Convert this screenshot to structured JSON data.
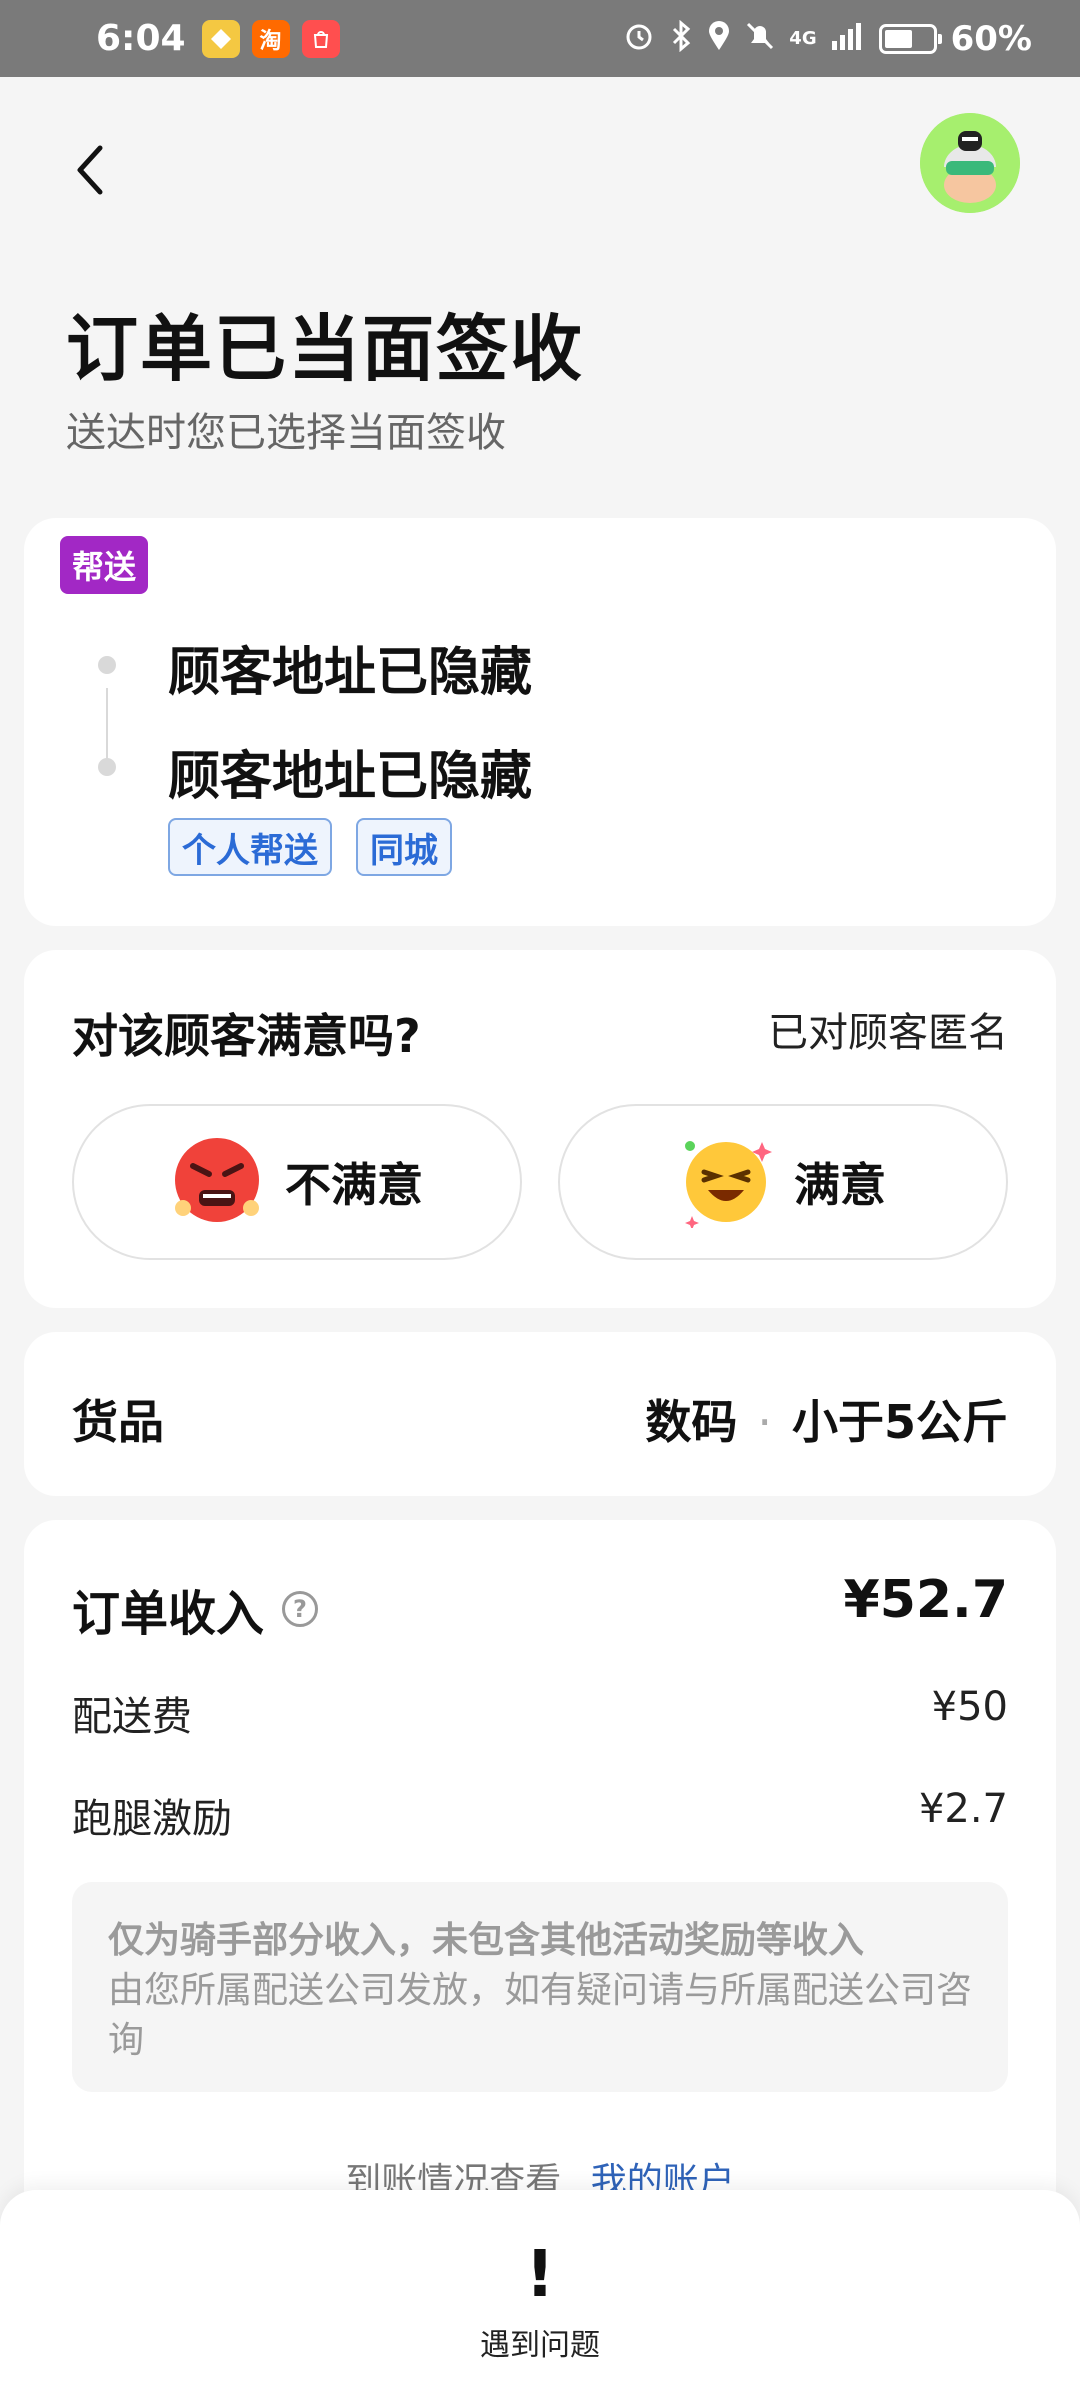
{
  "status_bar": {
    "time": "6:04",
    "apps": [
      {
        "name": "messaging-app-icon",
        "glyph": "",
        "color": "#f4c842"
      },
      {
        "name": "taobao-app-icon",
        "glyph": "淘",
        "color": "#ff6a00"
      },
      {
        "name": "huawei-app-icon",
        "glyph": "",
        "color": "#ff4f4f"
      }
    ],
    "network": "4G",
    "battery_percent": "60%",
    "battery_level": 0.6
  },
  "header": {
    "title": "订单已当面签收",
    "subtitle": "送达时您已选择当面签收"
  },
  "route_card": {
    "tag": "帮送",
    "tag_color": "#a228c5",
    "pickup": "顾客地址已隐藏",
    "dropoff": "顾客地址已隐藏",
    "chips": [
      "个人帮送",
      "同城"
    ]
  },
  "rating_card": {
    "question": "对该顾客满意吗?",
    "anonymous_note": "已对顾客匿名",
    "dissatisfied_label": "不满意",
    "satisfied_label": "满意"
  },
  "goods_card": {
    "label": "货品",
    "category": "数码",
    "separator": "·",
    "weight": "小于5公斤"
  },
  "income_card": {
    "label": "订单收入",
    "total": "¥52.7",
    "rows": [
      {
        "label": "配送费",
        "value": "¥50"
      },
      {
        "label": "跑腿激励",
        "value": "¥2.7"
      }
    ],
    "notice_title": "仅为骑手部分收入，未包含其他活动奖励等收入",
    "notice_body": "由您所属配送公司发放，如有疑问请与所属配送公司咨询",
    "account_prompt": "到账情况查看",
    "account_link": "我的账户"
  },
  "bottom_bar": {
    "issue_icon": "!",
    "issue_label": "遇到问题"
  }
}
